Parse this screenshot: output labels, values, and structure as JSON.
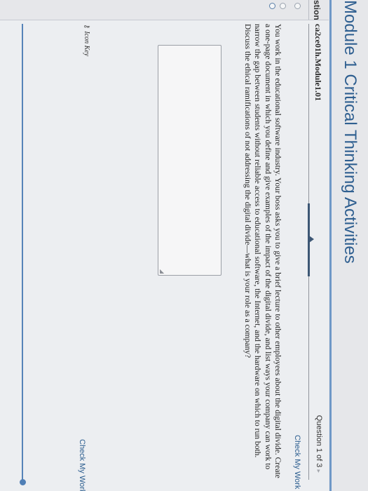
{
  "page": {
    "title": "Module 1 Critical Thinking Activities"
  },
  "left_column": {
    "label": "stions"
  },
  "question": {
    "id": "ca2ce01h.Module1.01",
    "counter": "Question 1 of 3",
    "counter_caret": "▸",
    "check_top": "Check My Work",
    "check_bottom": "Check My Work",
    "prompt": "You work in the educational software industry. Your boss asks you to give a brief lecture to other employees about the digital divide. Create a one-page document in which you define and give examples of the impact of the digital divide, and list ways your company can work to narrow the gap between students without reliable access to educational software, the Internet, and the hardware on which to run both. Discuss the ethical ramifications of not addressing the digital divide—what is your role as a company?",
    "answer_value": "",
    "icon_key_label": "Icon Key",
    "icon_key_icon": "key-icon"
  },
  "colors": {
    "title": "#2f5f90",
    "link": "#2b5d8f",
    "rule": "#6f98c7"
  }
}
